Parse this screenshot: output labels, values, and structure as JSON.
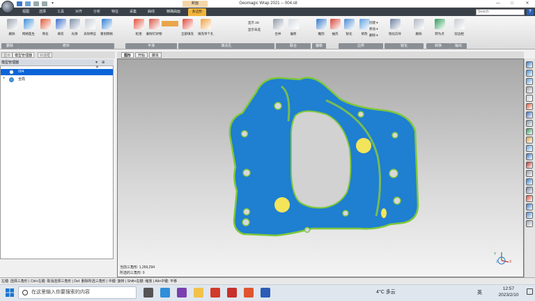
{
  "window": {
    "title": "Geomagic Wrap 2021 -- 004.stl",
    "context_tab": "断面",
    "controls": [
      "—",
      "□",
      "✕"
    ]
  },
  "menu": {
    "tabs": [
      "视图",
      "选择",
      "工具",
      "对齐",
      "分析",
      "特征",
      "采集",
      "曲线",
      "精确曲面",
      "多边形"
    ],
    "active": "多边形",
    "search_placeholder": "Search"
  },
  "ribbon": {
    "buttons": [
      {
        "label": "删除",
        "color": "#9aa3ad"
      },
      {
        "label": "网格医生",
        "color": "#3b8fd6"
      },
      {
        "label": "简化",
        "color": "#e05a3a"
      },
      {
        "label": "填充",
        "color": "#3b6fc9"
      },
      {
        "label": "光滑",
        "color": "#7b8fa6"
      },
      {
        "label": "去除特征",
        "color": "#c6ccd4"
      },
      {
        "label": "重划网格",
        "color": "#2f7fd0"
      },
      {
        "label": "松弛",
        "color": "#e14f3c"
      },
      {
        "label": "删除钉状物",
        "color": "#d9584a"
      },
      {
        "label": "全部填充",
        "color": "#e04a3c"
      },
      {
        "label": "填充单个孔",
        "color": "#f0a040"
      },
      {
        "label": "合并",
        "color": "#8f9aa6"
      },
      {
        "label": "偏移",
        "color": "#d6dbe0"
      },
      {
        "label": "雕刻",
        "color": "#3478c8"
      },
      {
        "label": "抽壳",
        "color": "#d6463a"
      },
      {
        "label": "锐化",
        "color": "#4a8ad4"
      },
      {
        "label": "修改",
        "color": "#5fa0e0"
      },
      {
        "label": "锐化向导",
        "color": "#6b7fa0"
      },
      {
        "label": "删除",
        "color": "#b0b8c2"
      },
      {
        "label": "转为点",
        "color": "#2f9c5a"
      },
      {
        "label": "双边相",
        "color": "#c8ccd2"
      }
    ],
    "groups": [
      "删除",
      "修补",
      "平滑",
      "填充孔",
      "联合",
      "偏移",
      "边界",
      "锐化",
      "转换",
      "输出"
    ],
    "extra": [
      "创建 ▾",
      "移动 ▾",
      "删除 ▾",
      "显示 2D",
      "显示未选"
    ]
  },
  "left_panel": {
    "tabs": [
      "显示",
      "模型管理器",
      "对话框"
    ],
    "active_tab": "模型管理器",
    "header": "模型管理器",
    "header_controls": "▾ ⊕ ✕",
    "tree": [
      {
        "label": "004",
        "selected": true
      },
      {
        "label": "全局",
        "selected": false
      }
    ]
  },
  "viewport": {
    "tabs": [
      "图形",
      "开始",
      "脚本"
    ],
    "active_tab": "图形",
    "stats": {
      "triangles": "当前三角形: 1,269,294",
      "selected": "所选的三角形: 0"
    },
    "axis_labels": [
      "Y",
      "Z",
      "X"
    ]
  },
  "status_bar": {
    "text": "左键: 选择三角形 | Ctrl+左键: 取消选择三角形 | Del: 删除所选三角形 | 中键: 旋转 | Shift+右键: 缩放 | Alt+中键: 平移"
  },
  "taskbar": {
    "search_placeholder": "在这里输入你要搜索的内容",
    "apps": [
      {
        "name": "task-view",
        "color": "#555"
      },
      {
        "name": "edge",
        "color": "#2f8fd8"
      },
      {
        "name": "onenote",
        "color": "#7b3fb0"
      },
      {
        "name": "file-explorer",
        "color": "#f2c14a"
      },
      {
        "name": "recorder",
        "color": "#d23a2a"
      },
      {
        "name": "dx",
        "color": "#c8302a"
      },
      {
        "name": "wps-word",
        "color": "#e0542e"
      },
      {
        "name": "word",
        "color": "#2b5cb8"
      }
    ],
    "weather": "4°C 多云",
    "lang": "英",
    "time": "12:57",
    "date": "2023/2/10"
  },
  "colors": {
    "mesh_blue": "#1f7fd0",
    "mesh_edge_green": "#7ec83a",
    "highlight_yellow": "#f3e45a",
    "active_tab": "#f2b53a",
    "selection_blue": "#0a64d8"
  }
}
